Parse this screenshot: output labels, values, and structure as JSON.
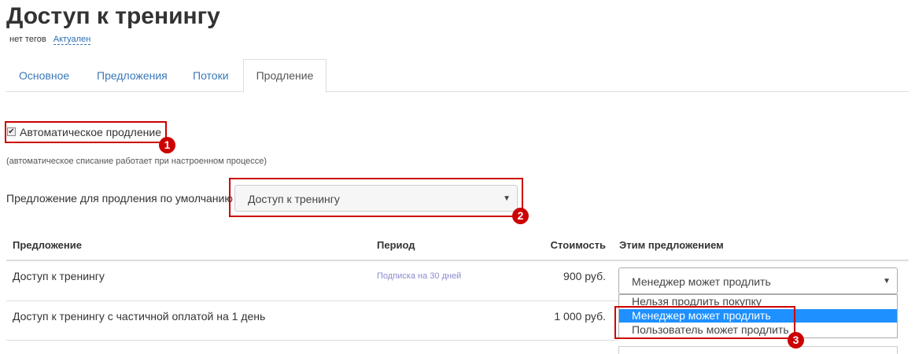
{
  "page": {
    "title": "Доступ к тренингу"
  },
  "tags": {
    "empty_label": "нет тегов",
    "status": "Актуален"
  },
  "tabs": [
    {
      "label": "Основное"
    },
    {
      "label": "Предложения"
    },
    {
      "label": "Потоки"
    },
    {
      "label": "Продление"
    }
  ],
  "renewal": {
    "auto_label": "Автоматическое продление",
    "auto_checked": true,
    "hint": "(автоматическое списание работает при настроенном процессе)",
    "default_label": "Предложение для продления по умолчанию",
    "default_value": "Доступ к тренингу"
  },
  "table": {
    "headers": [
      "Предложение",
      "Период",
      "Стоимость",
      "Этим предложением"
    ],
    "rows": [
      {
        "offer": "Доступ к тренингу",
        "period": "Подписка на 30 дней",
        "price": "900 руб.",
        "action": "Менеджер может продлить"
      },
      {
        "offer": "Доступ к тренингу с частичной оплатой на 1 день",
        "period": "",
        "price": "1 000 руб.",
        "action": ""
      }
    ]
  },
  "dropdown": {
    "options": [
      "Нельзя продлить покупку",
      "Менеджер может продлить",
      "Пользователь может продлить"
    ],
    "selected_index": 1
  },
  "annotations": {
    "marker1": "1",
    "marker2": "2",
    "marker3": "3"
  },
  "colors": {
    "accent_red": "#cc0000",
    "link_blue": "#3a79b8",
    "selected_option": "#1e90ff"
  }
}
